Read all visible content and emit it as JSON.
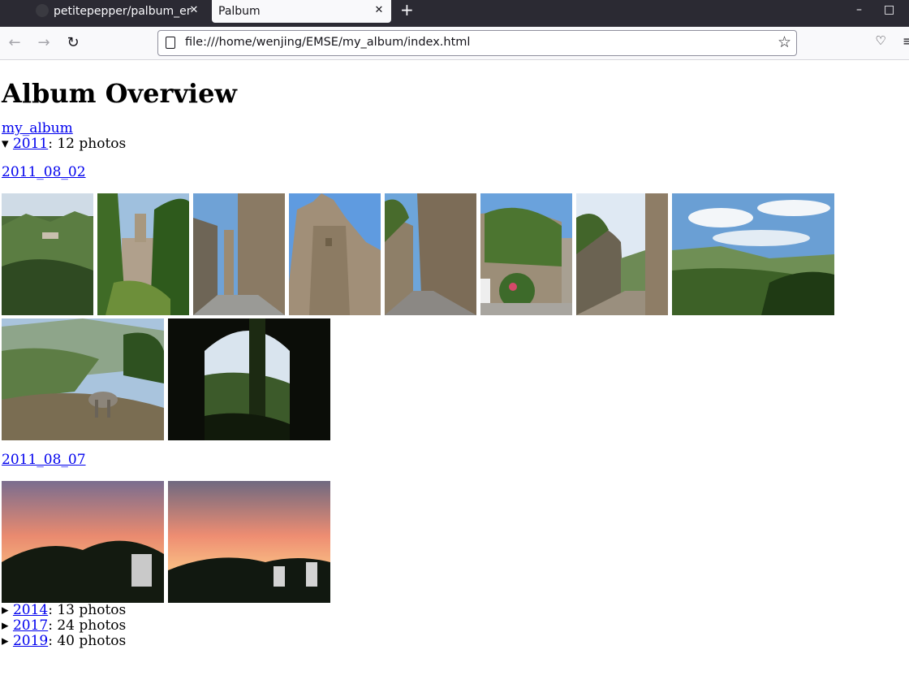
{
  "browser": {
    "tabs": [
      {
        "label": "petitepepper/palbum_em",
        "active": false
      },
      {
        "label": "Palbum",
        "active": true
      }
    ],
    "url": "file:///home/wenjing/EMSE/my_album/index.html"
  },
  "page": {
    "title": "Album Overview",
    "root_link": "my_album",
    "years": [
      {
        "marker": "▾",
        "year": "2011",
        "suffix": ": 12 photos",
        "expanded": true
      },
      {
        "marker": "▸",
        "year": "2014",
        "suffix": ": 13 photos",
        "expanded": false
      },
      {
        "marker": "▸",
        "year": "2017",
        "suffix": ": 24 photos",
        "expanded": false
      },
      {
        "marker": "▸",
        "year": "2019",
        "suffix": ": 40 photos",
        "expanded": false
      }
    ],
    "albums": [
      {
        "name": "2011_08_02",
        "photo_count": 10
      },
      {
        "name": "2011_08_07",
        "photo_count": 2
      }
    ]
  },
  "colors": {
    "link": "#0000ee",
    "chrome_dark": "#2b2a33",
    "toolbar": "#f9f9fb"
  }
}
